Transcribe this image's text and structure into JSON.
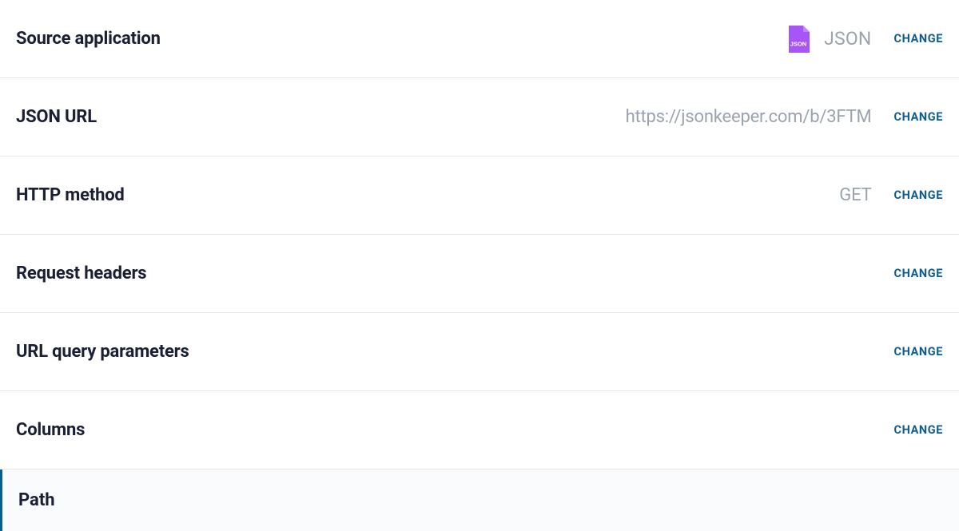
{
  "rows": {
    "sourceApplication": {
      "label": "Source application",
      "value": "JSON",
      "changeLabel": "CHANGE"
    },
    "jsonUrl": {
      "label": "JSON URL",
      "value": "https://jsonkeeper.com/b/3FTM",
      "changeLabel": "CHANGE"
    },
    "httpMethod": {
      "label": "HTTP method",
      "value": "GET",
      "changeLabel": "CHANGE"
    },
    "requestHeaders": {
      "label": "Request headers",
      "changeLabel": "CHANGE"
    },
    "urlQueryParameters": {
      "label": "URL query parameters",
      "changeLabel": "CHANGE"
    },
    "columns": {
      "label": "Columns",
      "changeLabel": "CHANGE"
    },
    "path": {
      "label": "Path"
    }
  },
  "iconText": "JSON"
}
